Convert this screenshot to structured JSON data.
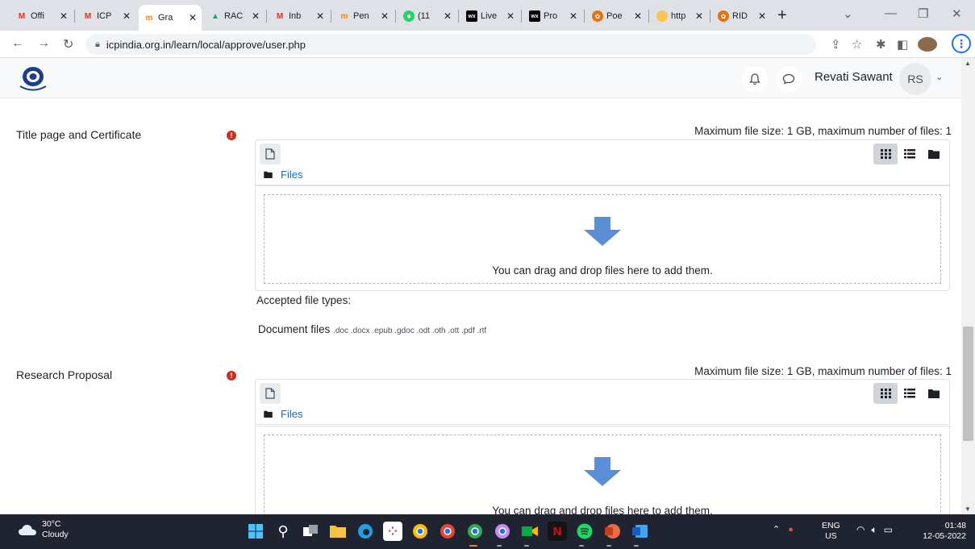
{
  "browser": {
    "tabs": [
      {
        "label": "Offi",
        "icon": "gmail-icon",
        "active": false
      },
      {
        "label": "ICP",
        "icon": "gmail-icon",
        "active": false
      },
      {
        "label": "Gra",
        "icon": "moodle-icon",
        "active": true
      },
      {
        "label": "RAC",
        "icon": "google-drive-icon",
        "active": false
      },
      {
        "label": "Inb",
        "icon": "gmail-icon",
        "active": false
      },
      {
        "label": "Pen",
        "icon": "moodle-icon",
        "active": false
      },
      {
        "label": "(11",
        "icon": "whatsapp-icon",
        "active": false
      },
      {
        "label": "Live",
        "icon": "wix-icon",
        "active": false
      },
      {
        "label": "Pro",
        "icon": "wix-icon",
        "active": false
      },
      {
        "label": "Poe",
        "icon": "poe-icon",
        "active": false
      },
      {
        "label": "http",
        "icon": "globe-icon",
        "active": false
      },
      {
        "label": "RID",
        "icon": "poe-icon",
        "active": false
      }
    ],
    "url": "icpindia.org.in/learn/local/approve/user.php",
    "colors": {
      "gmail": "#d93025",
      "moodle": "#f98012",
      "drive": "#1fa463",
      "wix": "#000000",
      "poe": "#e8710a",
      "accent": "#1a73e8"
    }
  },
  "moodle_nav": {
    "user_name": "Revati Sawant",
    "user_initials": "RS"
  },
  "form": {
    "fields": [
      {
        "label": "Title page and Certificate",
        "required_mark": "!",
        "max_size_text": "Maximum file size: 1 GB, maximum number of files: 1",
        "path_label": "Files",
        "drop_text": "You can drag and drop files here to add them."
      },
      {
        "label": "Research Proposal",
        "required_mark": "!",
        "max_size_text": "Maximum file size: 1 GB, maximum number of files: 1",
        "path_label": "Files",
        "drop_text": "You can drag and drop files here to add them."
      }
    ],
    "accepted_title": "Accepted file types:",
    "accepted_group": "Document files",
    "accepted_exts": ".doc .docx .epub .gdoc .odt .oth .ott .pdf .rtf"
  },
  "taskbar": {
    "weather_temp": "30°C",
    "weather_desc": "Cloudy",
    "lang_top": "ENG",
    "lang_bottom": "US",
    "time": "01:48",
    "date": "12-05-2022"
  }
}
